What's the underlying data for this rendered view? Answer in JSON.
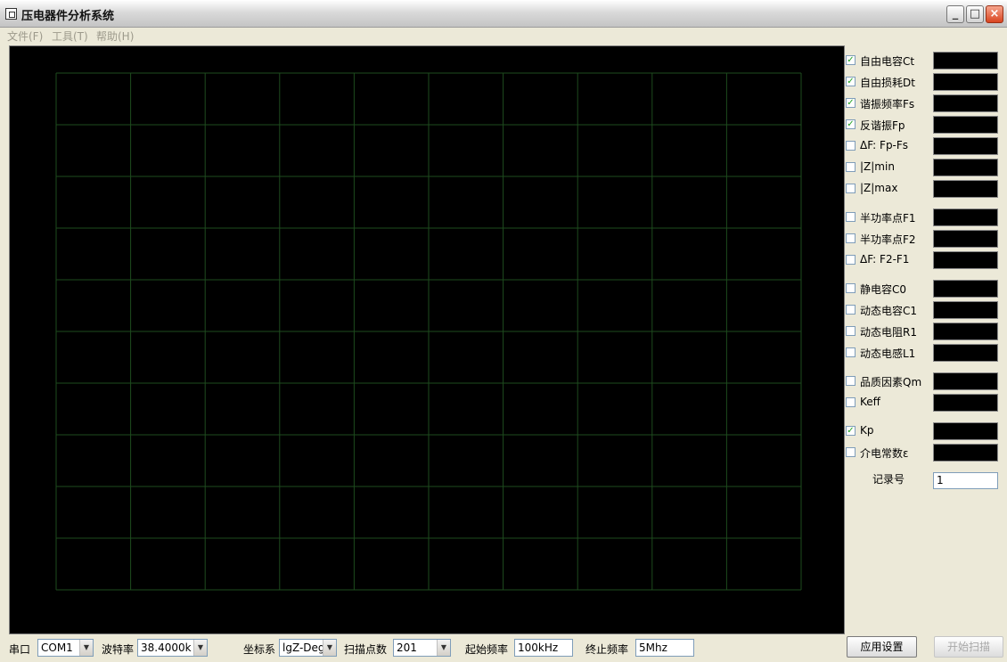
{
  "window": {
    "title": "压电器件分析系统",
    "minimize": "_",
    "maximize": "□",
    "close": "×"
  },
  "menu": [
    "文件(F)",
    "工具(T)",
    "帮助(H)"
  ],
  "plot": {
    "grid_color": "#1e4b1e",
    "background": "#000000",
    "columns": 10,
    "rows": 10
  },
  "params": [
    {
      "label": "自由电容Ct",
      "checked": true
    },
    {
      "label": "自由损耗Dt",
      "checked": true
    },
    {
      "label": "谐振频率Fs",
      "checked": true
    },
    {
      "label": "反谐振Fp",
      "checked": true
    },
    {
      "label": "ΔF: Fp-Fs",
      "checked": false
    },
    {
      "label": "|Z|min",
      "checked": false
    },
    {
      "label": "|Z|max",
      "checked": false
    },
    {
      "label": "半功率点F1",
      "checked": false
    },
    {
      "label": "半功率点F2",
      "checked": false
    },
    {
      "label": "ΔF: F2-F1",
      "checked": false
    },
    {
      "label": "静电容C0",
      "checked": false
    },
    {
      "label": "动态电容C1",
      "checked": false
    },
    {
      "label": "动态电阻R1",
      "checked": false
    },
    {
      "label": "动态电感L1",
      "checked": false
    },
    {
      "label": "品质因素Qm",
      "checked": false
    },
    {
      "label": "Keff",
      "checked": false
    },
    {
      "label": "Kp",
      "checked": true
    },
    {
      "label": "介电常数ε",
      "checked": false
    }
  ],
  "record": {
    "label": "记录号",
    "value": "1"
  },
  "bottom": {
    "port_label": "串口",
    "port_value": "COM1",
    "baud_label": "波特率",
    "baud_value": "38.4000k",
    "coord_label": "坐标系",
    "coord_value": "lgZ-Deg",
    "points_label": "扫描点数",
    "points_value": "201",
    "start_label": "起始频率",
    "start_value": "100kHz",
    "end_label": "终止频率",
    "end_value": "5Mhz",
    "apply_button": "应用设置",
    "start_scan_button": "开始扫描"
  }
}
